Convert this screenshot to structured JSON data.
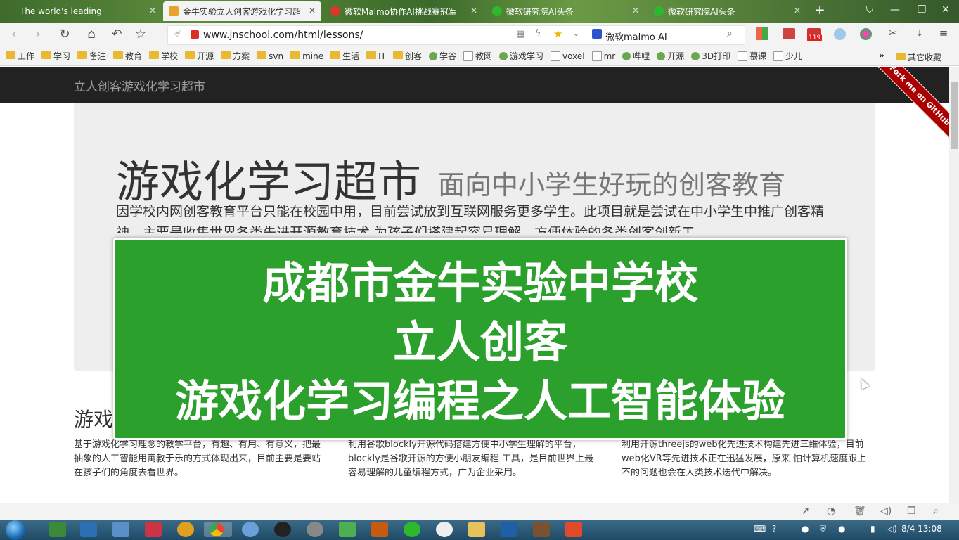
{
  "browser": {
    "tabs": [
      {
        "label": "The world's leading",
        "active": false
      },
      {
        "label": "金牛实验立人创客游戏化学习超",
        "active": true
      },
      {
        "label": "微软Malmo协作AI挑战赛冠军",
        "active": false
      },
      {
        "label": "微软研究院AI头条",
        "active": false
      },
      {
        "label": "微软研究院AI头条",
        "active": false
      }
    ],
    "new_tab": "+",
    "window_controls": {
      "minimize": "—",
      "restore": "❐",
      "close": "✕"
    },
    "url": "www.jnschool.com/html/lessons/",
    "search_text": "微软malmo AI",
    "mail_badge": "119",
    "bookmarks": [
      {
        "label": "工作",
        "type": "folder"
      },
      {
        "label": "学习",
        "type": "folder"
      },
      {
        "label": "备注",
        "type": "folder"
      },
      {
        "label": "教育",
        "type": "folder"
      },
      {
        "label": "学校",
        "type": "folder"
      },
      {
        "label": "开源",
        "type": "folder"
      },
      {
        "label": "方案",
        "type": "folder"
      },
      {
        "label": "svn",
        "type": "folder"
      },
      {
        "label": "mine",
        "type": "folder"
      },
      {
        "label": "生活",
        "type": "folder"
      },
      {
        "label": "IT",
        "type": "folder"
      },
      {
        "label": "创客",
        "type": "folder"
      },
      {
        "label": "学谷",
        "type": "site"
      },
      {
        "label": "教网",
        "type": "page"
      },
      {
        "label": "游戏学习",
        "type": "site"
      },
      {
        "label": "voxel",
        "type": "page"
      },
      {
        "label": "mr",
        "type": "page"
      },
      {
        "label": "哔哩",
        "type": "site"
      },
      {
        "label": "开源",
        "type": "site"
      },
      {
        "label": "3D打印",
        "type": "site"
      },
      {
        "label": "慕课",
        "type": "page"
      },
      {
        "label": "少儿",
        "type": "page"
      }
    ],
    "bookmarks_more": "»",
    "other_bookmarks": "其它收藏"
  },
  "site": {
    "brand": "立人创客游戏化学习超市",
    "ribbon": "Fork me on GitHub",
    "heading": "游戏化学习超市",
    "heading_sub": "面向中小学生好玩的创客教育",
    "lead": "因学校内网创客教育平台只能在校园中用，目前尝试放到互联网服务更多学生。此项目就是尝试在中小学生中推广创客精神，主要是收集世界各类先进开源教育技术,为孩子们搭建起容易理解，方便体验的各类创客创新工",
    "columns": [
      {
        "title": "游戏",
        "text": "基于游戏化学习理念的教学平台，有趣、有用、有意义，把最抽象的人工智能用寓教于乐的方式体现出来，目前主要是要站在孩子们的角度去看世界。"
      },
      {
        "title": "",
        "text": "利用谷歌blockly开源代码搭建方便中小学生理解的平台，blockly是谷歌开源的方便小朋友编程 工具，是目前世界上最容易理解的儿童编程方式，广为企业采用。"
      },
      {
        "title": "",
        "text": "利用开源threejs的web化先进技术构建先进三维体验，目前web化VR等先进技术正在迅猛发展，原来 怕计算机速度跟上不的问题也会在人类技术迭代中解决。"
      }
    ]
  },
  "banner": {
    "line1": "成都市金牛实验中学校",
    "line2": "立人创客",
    "line3": "游戏化学习编程之人工智能体验"
  },
  "taskbar": {
    "clock": "8/4 13:08"
  },
  "colors": {
    "banner": "#2ca02c",
    "navbar": "#222222",
    "jumbotron": "#eeeeee",
    "ribbon": "#aa0000"
  }
}
